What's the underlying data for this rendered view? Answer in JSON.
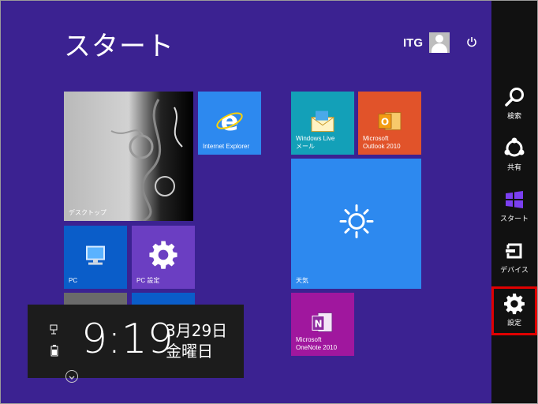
{
  "start": {
    "title": "スタート"
  },
  "user": {
    "name": "ITG"
  },
  "tiles": [
    {
      "label": "デスクトップ"
    },
    {
      "label": "Internet Explorer"
    },
    {
      "label": "Windows Live\nメール"
    },
    {
      "label": "Microsoft\nOutlook 2010"
    },
    {
      "label": "PC"
    },
    {
      "label": "PC 設定"
    },
    {
      "label": "天気"
    },
    {
      "label": "Microsoft\nOneNote 2010"
    }
  ],
  "charms": [
    {
      "label": "検索",
      "icon": "search-icon"
    },
    {
      "label": "共有",
      "icon": "share-icon"
    },
    {
      "label": "スタート",
      "icon": "windows-logo-icon"
    },
    {
      "label": "デバイス",
      "icon": "devices-icon"
    },
    {
      "label": "設定",
      "icon": "gear-icon"
    }
  ],
  "clock": {
    "time": "9:19",
    "date": "3月29日",
    "weekday": "金曜日"
  },
  "colors": {
    "background": "#3b2291",
    "ie": "#2d89ef",
    "outlook": "#e1532a",
    "mail": "#13a0b8",
    "pc": "#0a5dc9",
    "pc_settings": "#6b3ec2",
    "weather": "#2d89ef",
    "onenote": "#a0179e",
    "selection": "#e00000"
  }
}
